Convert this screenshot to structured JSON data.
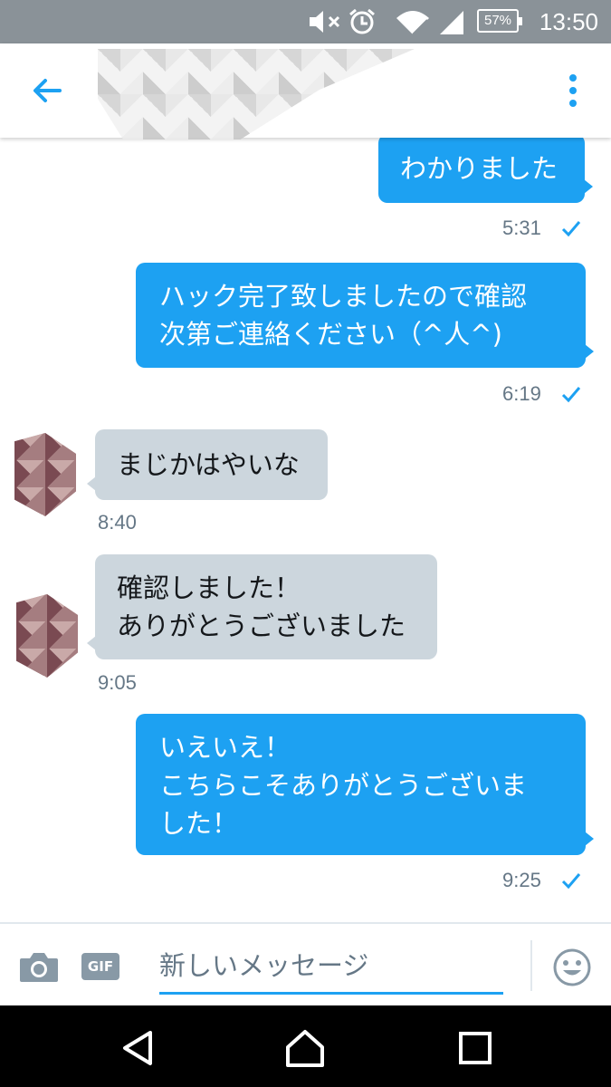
{
  "status_bar": {
    "time": "13:50",
    "battery": "57%",
    "icons": [
      "mute-icon",
      "alarm-icon",
      "wifi-icon",
      "signal-icon",
      "battery-icon"
    ]
  },
  "header": {
    "back_icon": "arrow-left-icon",
    "more_icon": "more-vertical-icon"
  },
  "messages": [
    {
      "side": "out",
      "text": "わかりました",
      "time": "5:31"
    },
    {
      "side": "out",
      "text": "ハック完了致しましたので確認\n次第ご連絡ください（^人^)",
      "time": "6:19"
    },
    {
      "side": "in",
      "text": "まじかはやいな",
      "time": "8:40"
    },
    {
      "side": "in",
      "text": "確認しました！\nありがとうございました",
      "time": "9:05"
    },
    {
      "side": "out",
      "text": "いえいえ！\nこちらこそありがとうございま\nした！",
      "time": "9:25"
    }
  ],
  "composer": {
    "placeholder": "新しいメッセージ",
    "gif_label": "GIF",
    "camera_icon": "camera-icon",
    "emoji_icon": "emoji-icon"
  },
  "colors": {
    "accent": "#1da1f2",
    "incoming_bubble": "#ccd6dd",
    "status_bar": "#8a9298",
    "meta_text": "#657786"
  }
}
